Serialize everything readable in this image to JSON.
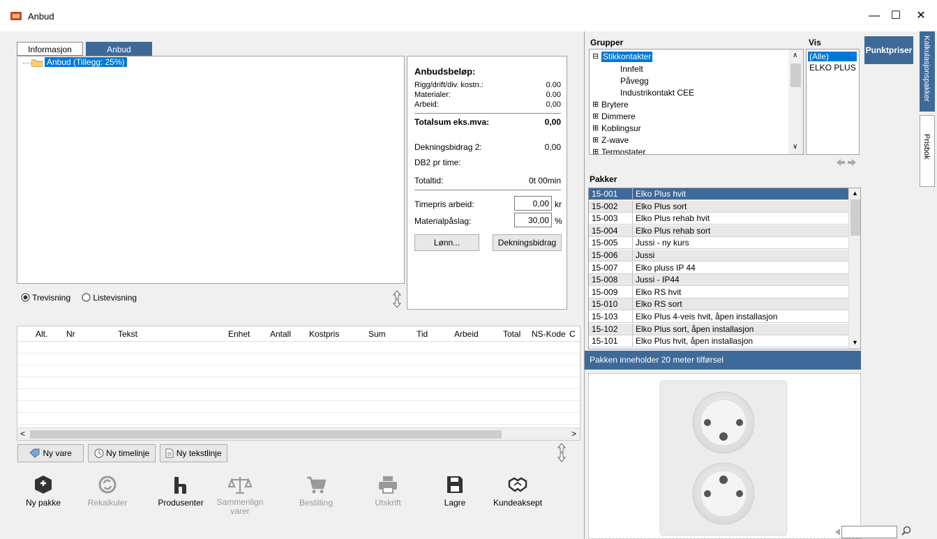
{
  "window": {
    "title": "Anbud",
    "minimize": "—",
    "maximize": "☐",
    "close": "✕"
  },
  "tabs": {
    "info": "Informasjon",
    "anbud": "Anbud"
  },
  "tree": {
    "root": "Anbud (Tillegg: 25%)"
  },
  "amount": {
    "heading": "Anbudsbeløp:",
    "rigg_label": "Rigg/drift/div. kostn.:",
    "rigg_value": "0.00",
    "mat_label": "Materialer:",
    "mat_value": "0.00",
    "arb_label": "Arbeid:",
    "arb_value": "0,00",
    "total_label": "Totalsum eks.mva:",
    "total_value": "0,00",
    "db2_label": "Dekningsbidrag 2:",
    "db2_value": "0,00",
    "db2h_label": "DB2 pr time:",
    "tid_label": "Totaltid:",
    "tid_value": "0t 00min",
    "timepris_label": "Timepris arbeid:",
    "timepris_value": "0,00",
    "timepris_unit": "kr",
    "paslag_label": "Materialpåslag:",
    "paslag_value": "30,00",
    "paslag_unit": "%",
    "lonn_btn": "Lønn...",
    "db_btn": "Dekningsbidrag"
  },
  "view": {
    "tree": "Trevisning",
    "list": "Listevisning"
  },
  "grid": {
    "columns": [
      "Alt.",
      "Nr",
      "Tekst",
      "Enhet",
      "Antall",
      "Kostpris",
      "Sum",
      "Tid",
      "Arbeid",
      "Total",
      "NS-Kode",
      "C"
    ]
  },
  "line_buttons": {
    "ny_vare": "Ny vare",
    "ny_time": "Ny timelinje",
    "ny_tekst": "Ny tekstlinje"
  },
  "toolbar": {
    "ny_pakke": "Ny pakke",
    "rekalkuler": "Rekalkuler",
    "produsenter": "Produsenter",
    "sammenlign": "Sammenlign varer",
    "bestilling": "Bestilling",
    "utskrift": "Utskrift",
    "lagre": "Lagre",
    "kundeaksept": "Kundeaksept"
  },
  "groups": {
    "heading": "Grupper",
    "vis_heading": "Vis",
    "items": [
      "Stikkontakter",
      "Innfelt",
      "Påvegg",
      "Industrikontakt CEE",
      "Brytere",
      "Dimmere",
      "Koblingsur",
      "Z-wave",
      "Termostater"
    ],
    "vis_items": [
      "(Alle)",
      "ELKO PLUS"
    ]
  },
  "punktpriser": "Punktpriser",
  "side_tabs": {
    "kalk": "Kalkulasjonspakker",
    "prisbok": "Prisbok"
  },
  "pakker": {
    "heading": "Pakker",
    "rows": [
      {
        "code": "15-001",
        "name": "Elko Plus hvit"
      },
      {
        "code": "15-002",
        "name": "Elko Plus sort"
      },
      {
        "code": "15-003",
        "name": "Elko Plus rehab hvit"
      },
      {
        "code": "15-004",
        "name": "Elko Plus rehab sort"
      },
      {
        "code": "15-005",
        "name": "Jussi - ny kurs"
      },
      {
        "code": "15-006",
        "name": "Jussi"
      },
      {
        "code": "15-007",
        "name": "Elko pluss IP 44"
      },
      {
        "code": "15-008",
        "name": "Jussi - IP44"
      },
      {
        "code": "15-009",
        "name": "Elko RS hvit"
      },
      {
        "code": "15-010",
        "name": "Elko RS sort"
      },
      {
        "code": "15-103",
        "name": "Elko Plus 4-veis hvit, åpen installasjon"
      },
      {
        "code": "15-102",
        "name": "Elko Plus sort, åpen installasjon"
      },
      {
        "code": "15-101",
        "name": "Elko Plus hvit, åpen installasjon"
      }
    ],
    "info": "Pakken inneholder 20 meter tilførsel"
  },
  "colors": {
    "accent": "#3d6a99",
    "select": "#0078d7"
  }
}
